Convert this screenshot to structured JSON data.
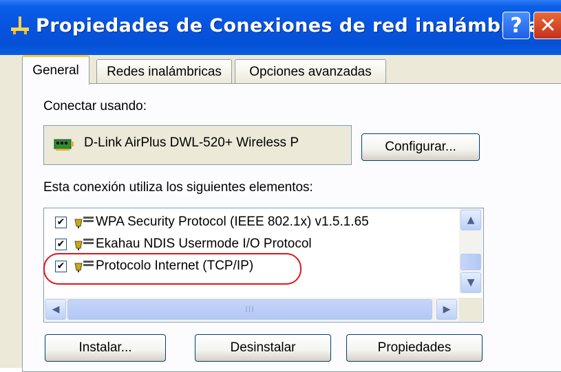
{
  "window": {
    "title": "Propiedades de Conexiones de red inalámbricas",
    "help_label": "?",
    "close_label": "✕"
  },
  "tabs": [
    {
      "label": "General",
      "active": true
    },
    {
      "label": "Redes inalámbricas",
      "active": false
    },
    {
      "label": "Opciones avanzadas",
      "active": false
    }
  ],
  "general": {
    "connect_using_label": "Conectar usando:",
    "adapter_name": "D-Link AirPlus DWL-520+ Wireless P",
    "configure_button": "Configurar...",
    "components_label": "Esta conexión utiliza los siguientes elementos:",
    "components": [
      {
        "label": "WPA Security Protocol (IEEE 802.1x) v1.5.1.65",
        "checked": true
      },
      {
        "label": "Ekahau NDIS Usermode I/O Protocol",
        "checked": true
      },
      {
        "label": "Protocolo Internet (TCP/IP)",
        "checked": true,
        "highlighted": true
      }
    ],
    "install_button": "Instalar...",
    "uninstall_button": "Desinstalar",
    "properties_button": "Propiedades"
  },
  "scrollbar": {
    "up_icon": "▲",
    "down_icon": "▼",
    "left_icon": "◀",
    "right_icon": "▶",
    "grip": "III"
  },
  "colors": {
    "titlebar": "#0550d6",
    "highlight": "#e0141a",
    "dialog_bg": "#ece9d8"
  }
}
